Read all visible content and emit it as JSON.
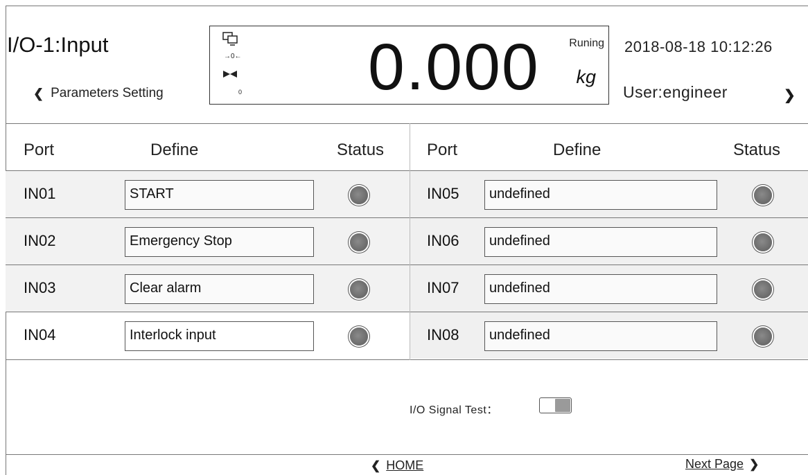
{
  "header": {
    "title": "I/O-1:Input",
    "back_label": "Parameters Setting",
    "datetime": "2018-08-18 10:12:26",
    "user": "User:engineer"
  },
  "weigh": {
    "value": "0.000",
    "status": "Runing",
    "unit": "kg",
    "indicator_small": "0",
    "icons": [
      "monitor-icon",
      "zero-tracking-icon",
      "stable-icon"
    ]
  },
  "table": {
    "headers": {
      "port": "Port",
      "define": "Define",
      "status": "Status"
    },
    "left_rows": [
      {
        "port": "IN01",
        "define": "START"
      },
      {
        "port": "IN02",
        "define": "Emergency Stop"
      },
      {
        "port": "IN03",
        "define": "Clear alarm"
      },
      {
        "port": "IN04",
        "define": "Interlock input"
      }
    ],
    "right_rows": [
      {
        "port": "IN05",
        "define": "undefined"
      },
      {
        "port": "IN06",
        "define": "undefined"
      },
      {
        "port": "IN07",
        "define": "undefined"
      },
      {
        "port": "IN08",
        "define": "undefined"
      }
    ]
  },
  "footer": {
    "signal_test_label": "I/O Signal Test：",
    "signal_test_on": false,
    "home_label": "HOME",
    "next_label": "Next Page"
  }
}
